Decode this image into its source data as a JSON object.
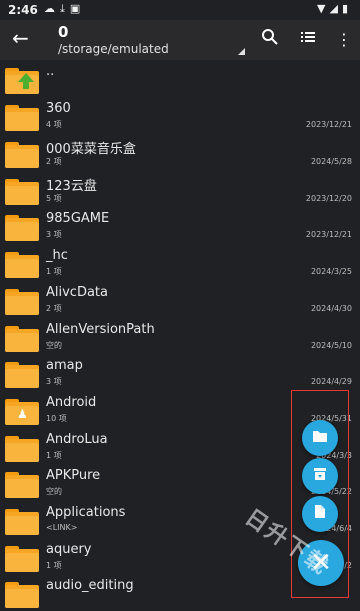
{
  "status_bar": {
    "time": "2:46",
    "left_icons": [
      "cloud-icon",
      "download-icon",
      "image-icon"
    ],
    "right_icons": [
      "wifi-icon",
      "signal-icon",
      "battery-icon"
    ]
  },
  "toolbar": {
    "title": "0",
    "path": "/storage/emulated"
  },
  "files": [
    {
      "name": "..",
      "meta": "",
      "date": "",
      "icon": "folder-up-icon"
    },
    {
      "name": "360",
      "meta": "4 项",
      "date": "2023/12/21",
      "icon": "folder-icon"
    },
    {
      "name": "000菜菜音乐盒",
      "meta": "2 项",
      "date": "2024/5/28",
      "icon": "folder-icon"
    },
    {
      "name": "123云盘",
      "meta": "5 项",
      "date": "2023/12/20",
      "icon": "folder-icon"
    },
    {
      "name": "985GAME",
      "meta": "3 项",
      "date": "2023/12/21",
      "icon": "folder-icon"
    },
    {
      "name": "_hc",
      "meta": "1 项",
      "date": "2024/3/25",
      "icon": "folder-icon"
    },
    {
      "name": "AlivcData",
      "meta": "2 项",
      "date": "2024/4/30",
      "icon": "folder-icon"
    },
    {
      "name": "AllenVersionPath",
      "meta": "空的",
      "date": "2024/5/10",
      "icon": "folder-icon"
    },
    {
      "name": "amap",
      "meta": "3 项",
      "date": "2024/4/29",
      "icon": "folder-icon"
    },
    {
      "name": "Android",
      "meta": "10 项",
      "date": "2024/5/31",
      "icon": "folder-android-icon"
    },
    {
      "name": "AndroLua",
      "meta": "1 项",
      "date": "2024/3/3",
      "icon": "folder-icon"
    },
    {
      "name": "APKPure",
      "meta": "空的",
      "date": "2024/5/22",
      "icon": "folder-icon"
    },
    {
      "name": "Applications",
      "meta": "<LINK>",
      "date": "2024/6/4",
      "icon": "folder-icon"
    },
    {
      "name": "aquery",
      "meta": "1 项",
      "date": "2024/2/2",
      "icon": "folder-icon"
    },
    {
      "name": "audio_editing",
      "meta": "",
      "date": "",
      "icon": "folder-icon"
    }
  ],
  "fab": {
    "items": [
      "folder-icon",
      "archive-icon",
      "file-icon"
    ],
    "main_icon": "close-icon",
    "accent": "#29a8e0"
  },
  "watermark": "日升下载"
}
